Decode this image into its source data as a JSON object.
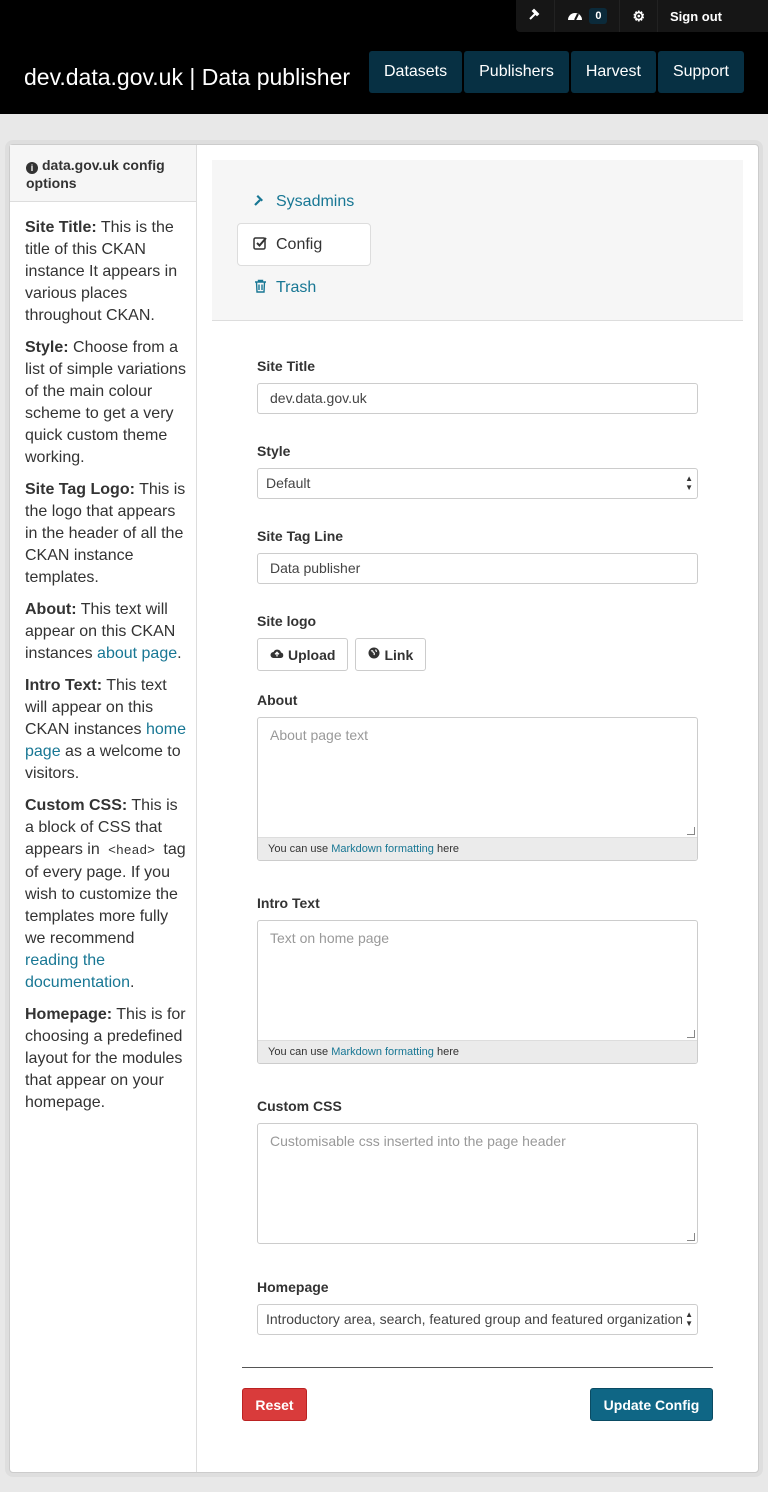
{
  "account": {
    "dashboard_count": "0",
    "sign_out": "Sign out"
  },
  "header": {
    "site_title": "dev.data.gov.uk | Data publisher",
    "nav": [
      "Datasets",
      "Publishers",
      "Harvest",
      "Support"
    ]
  },
  "sidebar": {
    "heading": "data.gov.uk config options",
    "items": {
      "site_title": {
        "term": "Site Title:",
        "text": " This is the title of this CKAN instance It appears in various places throughout CKAN."
      },
      "style": {
        "term": "Style:",
        "text": " Choose from a list of simple variations of the main colour scheme to get a very quick custom theme working."
      },
      "logo": {
        "term": "Site Tag Logo:",
        "text": " This is the logo that appears in the header of all the CKAN instance templates."
      },
      "about": {
        "term": "About:",
        "text": " This text will appear on this CKAN instances ",
        "link": "about page",
        "after": "."
      },
      "intro": {
        "term": "Intro Text:",
        "text": " This text will appear on this CKAN instances ",
        "link": "home page",
        "after": " as a welcome to visitors."
      },
      "css": {
        "term": "Custom CSS:",
        "text": " This is a block of CSS that appears in ",
        "code": "<head>",
        "text2": " tag of every page. If you wish to customize the templates more fully we recommend ",
        "link": "reading the documentation",
        "after": "."
      },
      "homepage": {
        "term": "Homepage:",
        "text": " This is for choosing a predefined layout for the modules that appear on your homepage."
      }
    }
  },
  "admin_tabs": {
    "sysadmins": "Sysadmins",
    "config": "Config",
    "trash": "Trash"
  },
  "form": {
    "site_title": {
      "label": "Site Title",
      "value": "dev.data.gov.uk"
    },
    "style": {
      "label": "Style",
      "value": "Default"
    },
    "tag_line": {
      "label": "Site Tag Line",
      "value": "Data publisher"
    },
    "logo": {
      "label": "Site logo",
      "upload": "Upload",
      "link": "Link"
    },
    "about": {
      "label": "About",
      "placeholder": "About page text"
    },
    "intro": {
      "label": "Intro Text",
      "placeholder": "Text on home page"
    },
    "css": {
      "label": "Custom CSS",
      "placeholder": "Customisable css inserted into the page header"
    },
    "homepage": {
      "label": "Homepage",
      "value": "Introductory area, search, featured group and featured organization"
    },
    "markdown": {
      "prefix": "You can use ",
      "link": "Markdown formatting",
      "suffix": " here"
    },
    "reset": "Reset",
    "update": "Update Config"
  }
}
